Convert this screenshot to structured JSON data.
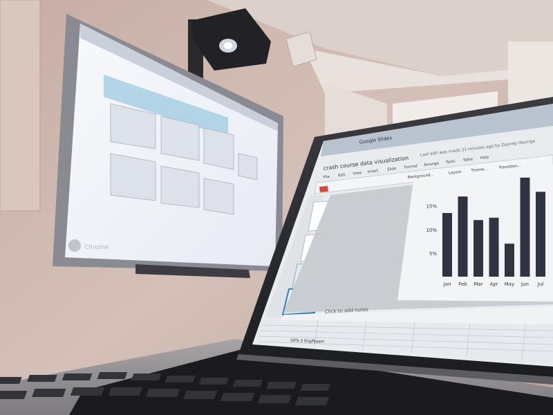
{
  "colors": {
    "wall": "#cdb8b0",
    "ceiling": "#d9ccc6",
    "board_screen": "#eef1f6",
    "laptop_body": "#2a2b30",
    "chart_bar": "#2f3440",
    "slide_bg": "#f3f4f5",
    "keyboard": "#1b1b1f"
  },
  "whiteboard": {
    "logo_text": "Chrome"
  },
  "laptop": {
    "browser_tab": "Google Slides",
    "doc_title": "crash course data visualization",
    "menu": [
      "File",
      "Edit",
      "View",
      "Insert",
      "Slide",
      "Format",
      "Arrange",
      "Tools",
      "Table",
      "Help"
    ],
    "last_edit": "Last edit was made 21 minutes ago by Zeynep Hevinge",
    "toolbar_items": [
      "Background...",
      "Layout",
      "Theme...",
      "Transition..."
    ],
    "speaker_notes_placeholder": "Click to add notes",
    "sheet_tab": "GPS-3 Erg/Naam"
  },
  "chart_data": {
    "type": "bar",
    "categories": [
      "Jan",
      "Feb",
      "Mar",
      "Apr",
      "May",
      "Jun",
      "Jul"
    ],
    "values": [
      13.5,
      17,
      12,
      12.5,
      7,
      21,
      18
    ],
    "ylim": [
      0,
      22
    ],
    "yticks": [
      5,
      10,
      15
    ],
    "ytick_labels": [
      "5%",
      "10%",
      "15%"
    ],
    "grid": false,
    "legend": "none"
  }
}
